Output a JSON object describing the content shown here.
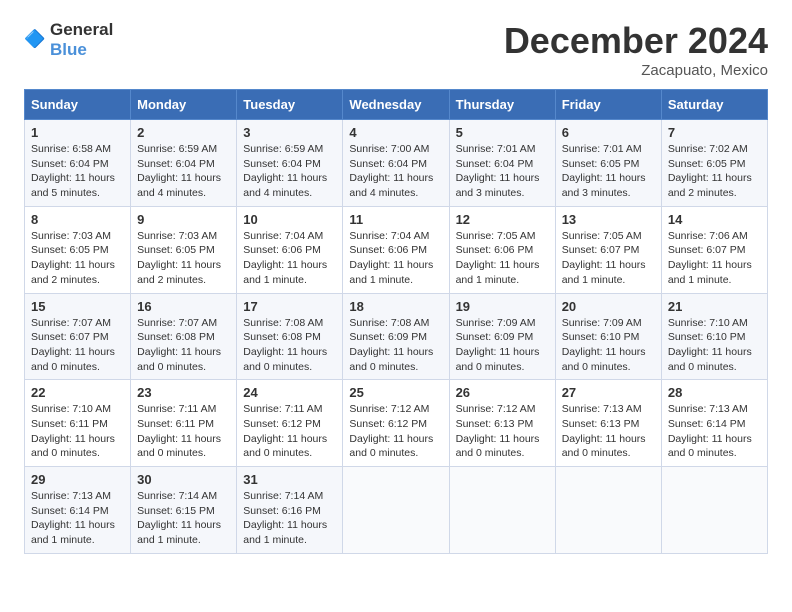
{
  "header": {
    "logo_general": "General",
    "logo_blue": "Blue",
    "month": "December 2024",
    "location": "Zacapuato, Mexico"
  },
  "days_of_week": [
    "Sunday",
    "Monday",
    "Tuesday",
    "Wednesday",
    "Thursday",
    "Friday",
    "Saturday"
  ],
  "weeks": [
    [
      {
        "day": "1",
        "info": "Sunrise: 6:58 AM\nSunset: 6:04 PM\nDaylight: 11 hours and 5 minutes."
      },
      {
        "day": "2",
        "info": "Sunrise: 6:59 AM\nSunset: 6:04 PM\nDaylight: 11 hours and 4 minutes."
      },
      {
        "day": "3",
        "info": "Sunrise: 6:59 AM\nSunset: 6:04 PM\nDaylight: 11 hours and 4 minutes."
      },
      {
        "day": "4",
        "info": "Sunrise: 7:00 AM\nSunset: 6:04 PM\nDaylight: 11 hours and 4 minutes."
      },
      {
        "day": "5",
        "info": "Sunrise: 7:01 AM\nSunset: 6:04 PM\nDaylight: 11 hours and 3 minutes."
      },
      {
        "day": "6",
        "info": "Sunrise: 7:01 AM\nSunset: 6:05 PM\nDaylight: 11 hours and 3 minutes."
      },
      {
        "day": "7",
        "info": "Sunrise: 7:02 AM\nSunset: 6:05 PM\nDaylight: 11 hours and 2 minutes."
      }
    ],
    [
      {
        "day": "8",
        "info": "Sunrise: 7:03 AM\nSunset: 6:05 PM\nDaylight: 11 hours and 2 minutes."
      },
      {
        "day": "9",
        "info": "Sunrise: 7:03 AM\nSunset: 6:05 PM\nDaylight: 11 hours and 2 minutes."
      },
      {
        "day": "10",
        "info": "Sunrise: 7:04 AM\nSunset: 6:06 PM\nDaylight: 11 hours and 1 minute."
      },
      {
        "day": "11",
        "info": "Sunrise: 7:04 AM\nSunset: 6:06 PM\nDaylight: 11 hours and 1 minute."
      },
      {
        "day": "12",
        "info": "Sunrise: 7:05 AM\nSunset: 6:06 PM\nDaylight: 11 hours and 1 minute."
      },
      {
        "day": "13",
        "info": "Sunrise: 7:05 AM\nSunset: 6:07 PM\nDaylight: 11 hours and 1 minute."
      },
      {
        "day": "14",
        "info": "Sunrise: 7:06 AM\nSunset: 6:07 PM\nDaylight: 11 hours and 1 minute."
      }
    ],
    [
      {
        "day": "15",
        "info": "Sunrise: 7:07 AM\nSunset: 6:07 PM\nDaylight: 11 hours and 0 minutes."
      },
      {
        "day": "16",
        "info": "Sunrise: 7:07 AM\nSunset: 6:08 PM\nDaylight: 11 hours and 0 minutes."
      },
      {
        "day": "17",
        "info": "Sunrise: 7:08 AM\nSunset: 6:08 PM\nDaylight: 11 hours and 0 minutes."
      },
      {
        "day": "18",
        "info": "Sunrise: 7:08 AM\nSunset: 6:09 PM\nDaylight: 11 hours and 0 minutes."
      },
      {
        "day": "19",
        "info": "Sunrise: 7:09 AM\nSunset: 6:09 PM\nDaylight: 11 hours and 0 minutes."
      },
      {
        "day": "20",
        "info": "Sunrise: 7:09 AM\nSunset: 6:10 PM\nDaylight: 11 hours and 0 minutes."
      },
      {
        "day": "21",
        "info": "Sunrise: 7:10 AM\nSunset: 6:10 PM\nDaylight: 11 hours and 0 minutes."
      }
    ],
    [
      {
        "day": "22",
        "info": "Sunrise: 7:10 AM\nSunset: 6:11 PM\nDaylight: 11 hours and 0 minutes."
      },
      {
        "day": "23",
        "info": "Sunrise: 7:11 AM\nSunset: 6:11 PM\nDaylight: 11 hours and 0 minutes."
      },
      {
        "day": "24",
        "info": "Sunrise: 7:11 AM\nSunset: 6:12 PM\nDaylight: 11 hours and 0 minutes."
      },
      {
        "day": "25",
        "info": "Sunrise: 7:12 AM\nSunset: 6:12 PM\nDaylight: 11 hours and 0 minutes."
      },
      {
        "day": "26",
        "info": "Sunrise: 7:12 AM\nSunset: 6:13 PM\nDaylight: 11 hours and 0 minutes."
      },
      {
        "day": "27",
        "info": "Sunrise: 7:13 AM\nSunset: 6:13 PM\nDaylight: 11 hours and 0 minutes."
      },
      {
        "day": "28",
        "info": "Sunrise: 7:13 AM\nSunset: 6:14 PM\nDaylight: 11 hours and 0 minutes."
      }
    ],
    [
      {
        "day": "29",
        "info": "Sunrise: 7:13 AM\nSunset: 6:14 PM\nDaylight: 11 hours and 1 minute."
      },
      {
        "day": "30",
        "info": "Sunrise: 7:14 AM\nSunset: 6:15 PM\nDaylight: 11 hours and 1 minute."
      },
      {
        "day": "31",
        "info": "Sunrise: 7:14 AM\nSunset: 6:16 PM\nDaylight: 11 hours and 1 minute."
      },
      {
        "day": "",
        "info": ""
      },
      {
        "day": "",
        "info": ""
      },
      {
        "day": "",
        "info": ""
      },
      {
        "day": "",
        "info": ""
      }
    ]
  ]
}
